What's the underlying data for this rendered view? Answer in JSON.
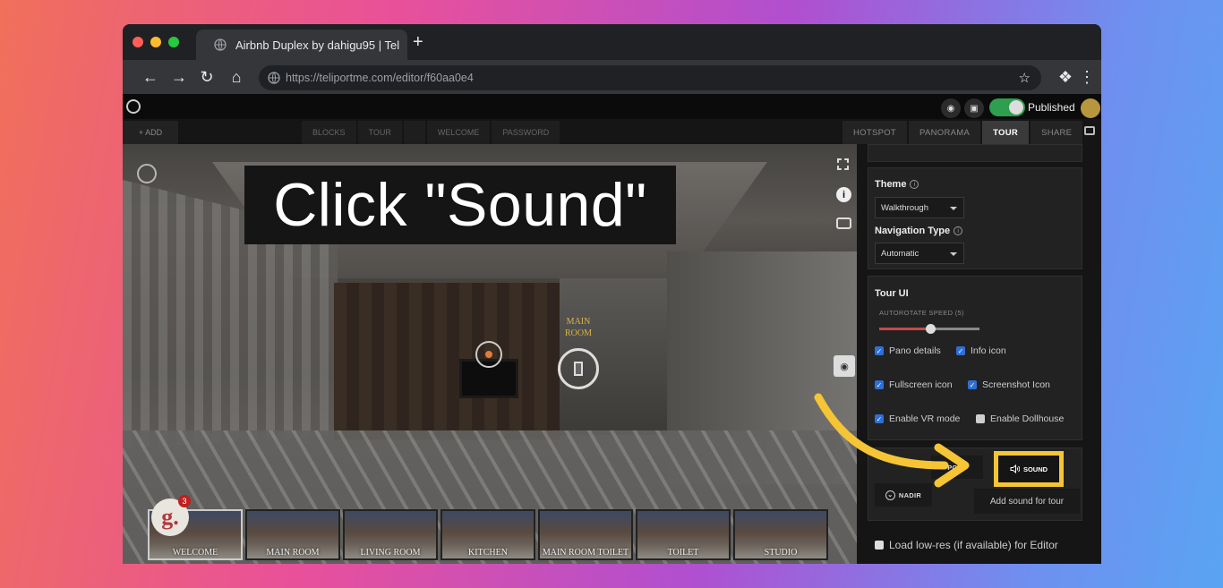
{
  "browser": {
    "tab_title": "Airbnb Duplex by dahigu95 | Tel",
    "url": "https://teliportme.com/editor/f60aa0e4",
    "new_tab": "+"
  },
  "app": {
    "published_label": "Published",
    "add_label": "+ ADD",
    "left_tabs": [
      "BLOCKS",
      "TOUR",
      "",
      "WELCOME",
      "PASSWORD"
    ],
    "right_tabs": [
      "HOTSPOT",
      "PANORAMA",
      "TOUR",
      "SHARE"
    ],
    "active_right_tab": "TOUR"
  },
  "caption": "Click \"Sound\"",
  "pano": {
    "room_label_line1": "MAIN",
    "room_label_line2": "ROOM",
    "badge_letter": "g.",
    "badge_count": "3",
    "thumbnails": [
      "WELCOME",
      "MAIN ROOM",
      "LIVING ROOM",
      "KITCHEN",
      "MAIN ROOM TOILET",
      "TOILET",
      "STUDIO"
    ]
  },
  "panel": {
    "theme_title": "Theme",
    "theme_value": "Walkthrough",
    "navigation_title": "Navigation Type",
    "navigation_value": "Automatic",
    "tour_ui_title": "Tour UI",
    "autorotate_label": "AUTOROTATE SPEED (5)",
    "autorotate_speed": 5,
    "checkboxes": {
      "pano_details": {
        "label": "Pano details",
        "checked": true
      },
      "info_icon": {
        "label": "Info icon",
        "checked": true
      },
      "fullscreen_icon": {
        "label": "Fullscreen icon",
        "checked": true
      },
      "screenshot_icon": {
        "label": "Screenshot Icon",
        "checked": true
      },
      "enable_vr": {
        "label": "Enable VR mode",
        "checked": true
      },
      "enable_dollhouse": {
        "label": "Enable Dollhouse",
        "checked": false
      }
    },
    "hotspots_btn": "POTS",
    "sound_btn": "SOUND",
    "nadir_btn": "NADIR",
    "sound_tooltip": "Add sound for tour",
    "lowres_label": "Load low-res (if available) for Editor"
  },
  "colors": {
    "highlight": "#f5c535",
    "toggle_on": "#2e9e4f",
    "checkbox": "#2f6fd6"
  }
}
